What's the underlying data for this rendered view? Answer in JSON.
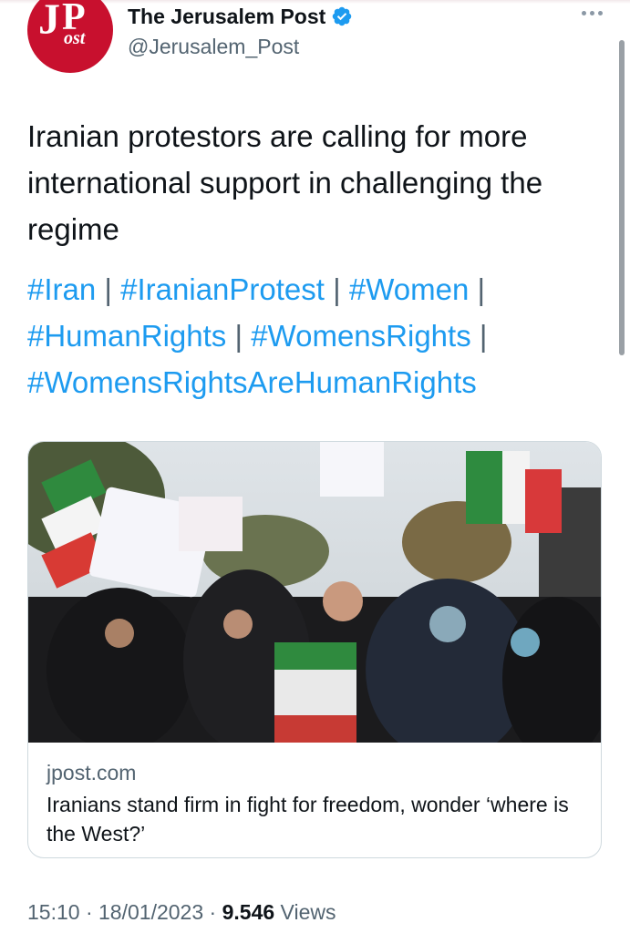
{
  "author": {
    "display_name": "The Jerusalem Post",
    "handle": "@Jerusalem_Post",
    "avatar_icon": "jpost-logo-icon",
    "avatar_text_j": "J",
    "avatar_text_p": "P",
    "avatar_text_ost": "ost",
    "verified_icon": "verified-badge-icon",
    "more_icon": "more-options-icon"
  },
  "tweet": {
    "text": "Iranian protestors are calling for more international support in challenging the regime",
    "hashtags": [
      "#Iran",
      "#IranianProtest",
      "#Women",
      "#HumanRights",
      "#WomensRights",
      "#WomensRightsAreHumanRights"
    ],
    "separator": "|"
  },
  "link_card": {
    "domain": "jpost.com",
    "title": "Iranians stand firm in fight for freedom, wonder ‘where is the West?’",
    "image_icon": "protest-photo-image"
  },
  "meta": {
    "time": "15:10",
    "date": "18/01/2023",
    "dot": "·",
    "views_count": "9.546",
    "views_label": "Views"
  },
  "colors": {
    "accent": "#1d9bf0",
    "brand_red": "#c8102e",
    "text_primary": "#0f1419",
    "text_secondary": "#536471",
    "border": "#cfd9de"
  }
}
